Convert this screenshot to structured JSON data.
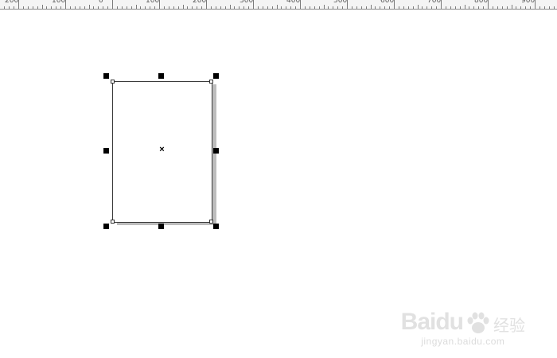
{
  "ruler": {
    "labels": [
      "200",
      "100",
      "0",
      "100",
      "200",
      "300",
      "400",
      "500",
      "600",
      "700",
      "800",
      "900"
    ]
  },
  "canvas": {
    "selected_object": "rectangle",
    "handles": [
      "top-left",
      "top-center",
      "top-right",
      "middle-left",
      "middle-right",
      "bottom-left",
      "bottom-center",
      "bottom-right"
    ],
    "center_marker": "×"
  },
  "watermark": {
    "logo": "Baidu",
    "cn": "经验",
    "url": "jingyan.baidu.com"
  },
  "colors": {
    "ruler_bg": "#f4f4f4",
    "shadow": "#bdbdbd",
    "handle": "#000000",
    "page": "#ffffff"
  }
}
